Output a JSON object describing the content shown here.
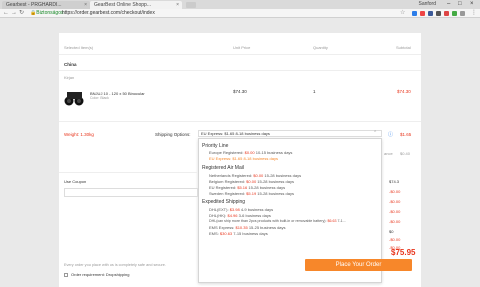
{
  "browser": {
    "tabs": [
      {
        "title": "Gearbest - PRGHARDI..."
      },
      {
        "title": "GearBest Online Shopp..."
      }
    ],
    "user": "Sanford",
    "secure_label": "Biztonságos",
    "url": "https://order.gearbest.com/checkout/index"
  },
  "table": {
    "headers": [
      "Selected Item(s)",
      "Unit Price",
      "Quantity",
      "Subtotal"
    ],
    "country": "China",
    "warehouse": "Kirjan",
    "product": {
      "name": "BNJUJ 10 - 120 x 50 Binocular",
      "variant_label": "Color:",
      "variant_value": "Black",
      "unit_price": "$74.30",
      "quantity": "1",
      "subtotal": "$74.30"
    }
  },
  "shipping": {
    "weight": "Weight: 1.30kg",
    "label": "Shipping Options:",
    "selected": "EU Express: $1.65 8-18 business days",
    "cost": "$1.65",
    "side_text": "ance",
    "side_value": "$0.40",
    "groups": [
      {
        "name": "Priority Line",
        "options": [
          {
            "name": "Europe Registered:",
            "price": "$0.00",
            "days": "10-15 business days",
            "highlight": false
          },
          {
            "name": "EU Express:",
            "price": "$1.65",
            "days": "8-18 business days",
            "highlight": true
          }
        ]
      },
      {
        "name": "Registered Air Mail",
        "options": [
          {
            "name": "Netherlands Registered:",
            "price": "$0.00",
            "days": "15-28 business days",
            "highlight": false
          },
          {
            "name": "Belgium Registered:",
            "price": "$0.00",
            "days": "15-28 business days",
            "highlight": false
          },
          {
            "name": "EU Registered:",
            "price": "$5.16",
            "days": "15-28 business days",
            "highlight": false
          },
          {
            "name": "Sweden Registered:",
            "price": "$5.19",
            "days": "15-28 business days",
            "highlight": false
          }
        ]
      },
      {
        "name": "Expedited Shipping",
        "options": [
          {
            "name": "DHL(EXT):",
            "price": "$3.98",
            "days": "4-9 business days",
            "highlight": false
          },
          {
            "name": "DHL(HK):",
            "price": "$4.96",
            "days": "3-6 business days",
            "highlight": false
          },
          {
            "name": "DHL(can ship more than 2pcs products with built-in or removable battery):",
            "price": "$6.63",
            "days": "7-1...",
            "highlight": false
          },
          {
            "name": "EMS Express:",
            "price": "$10.35",
            "days": "15-25 business days",
            "highlight": false
          },
          {
            "name": "EMS:",
            "price": "$30.63",
            "days": "7-15 business days",
            "highlight": false
          }
        ]
      }
    ]
  },
  "coupon": {
    "label": "Use Coupon"
  },
  "summary": {
    "values": [
      "$74.3",
      "-$0.00",
      "-$0.00",
      "-$0.00",
      "-$0.00",
      "$0",
      "-$0.00",
      "-$0.00"
    ],
    "total": "$75.95"
  },
  "footer": {
    "note": "Every order you place with us is completely safe and secure.",
    "dropship_label": "Order requirement: Dropshipping",
    "place_order": "Place Your Order"
  },
  "colors": {
    "accent": "#f7872a",
    "price": "#e8351c",
    "secure": "#1a8a2a"
  }
}
